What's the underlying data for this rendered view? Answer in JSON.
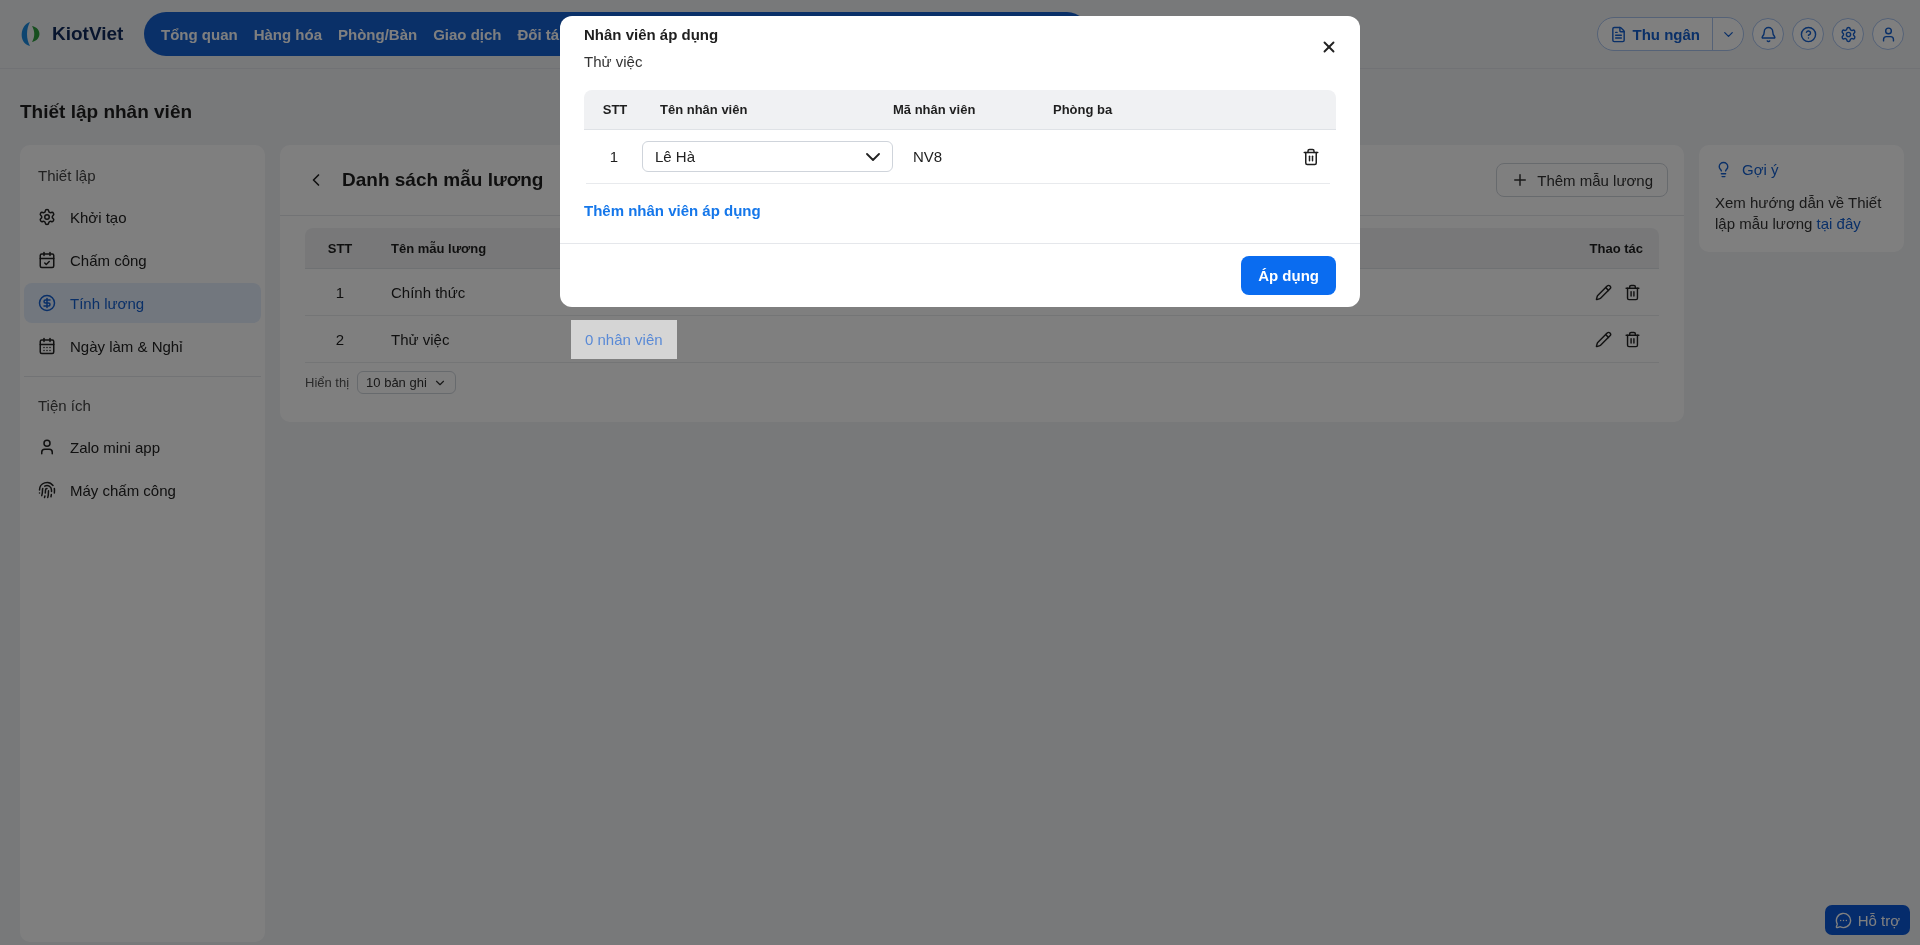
{
  "app": {
    "logo": "KiotViet",
    "nav": [
      "Tổng quan",
      "Hàng hóa",
      "Phòng/Bàn",
      "Giao dịch",
      "Đối tá"
    ],
    "cashier_button": "Thu ngân"
  },
  "page_title": "Thiết lập nhân viên",
  "sidebar": {
    "sections": [
      {
        "title": "Thiết lập",
        "items": [
          {
            "label": "Khởi tạo",
            "selected": false
          },
          {
            "label": "Chấm công",
            "selected": false
          },
          {
            "label": "Tính lương",
            "selected": true
          },
          {
            "label": "Ngày làm & Nghỉ",
            "selected": false
          }
        ]
      },
      {
        "title": "Tiện ích",
        "items": [
          {
            "label": "Zalo mini app",
            "selected": false
          },
          {
            "label": "Máy chấm công",
            "selected": false
          }
        ]
      }
    ]
  },
  "main": {
    "title": "Danh sách mẫu lương",
    "add_button": "Thêm mẫu lương",
    "table": {
      "columns": [
        "STT",
        "Tên mẫu lương",
        "Thao tác"
      ],
      "rows": [
        {
          "stt": "1",
          "name": "Chính thức"
        },
        {
          "stt": "2",
          "name": "Thử việc",
          "employees": "0 nhân viên",
          "highlighted": true
        }
      ]
    },
    "pagination": {
      "label": "Hiển thị",
      "page_size": "10 bản ghi"
    }
  },
  "hint": {
    "title": "Gợi ý",
    "text": "Xem hướng dẫn về Thiết lập mẫu lương",
    "link": "tại đây"
  },
  "modal": {
    "title": "Nhân viên áp dụng",
    "subtitle": "Thử việc",
    "columns": [
      "STT",
      "Tên nhân viên",
      "Mã nhân viên",
      "Phòng ba"
    ],
    "rows": [
      {
        "stt": "1",
        "employee": "Lê Hà",
        "code": "NV8"
      }
    ],
    "add_link": "Thêm nhân viên áp dụng",
    "apply_button": "Áp dụng"
  },
  "support_button": "Hỗ trợ"
}
